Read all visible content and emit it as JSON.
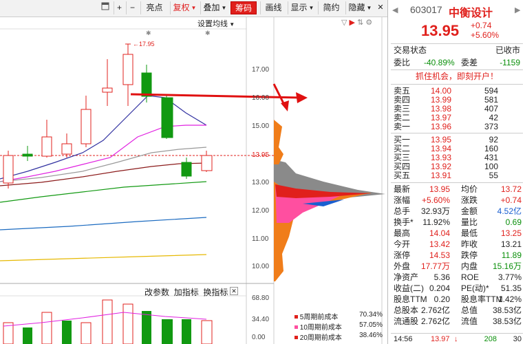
{
  "toolbar": {
    "buttons": [
      {
        "label": "亮点",
        "dropdown": false
      },
      {
        "label": "复权",
        "dropdown": true
      },
      {
        "label": "叠加",
        "dropdown": true
      },
      {
        "label": "筹码",
        "dropdown": false
      },
      {
        "label": "画线",
        "dropdown": false
      },
      {
        "label": "显示",
        "dropdown": true
      },
      {
        "label": "简约",
        "dropdown": false
      },
      {
        "label": "隐藏",
        "dropdown": true
      }
    ]
  },
  "chart": {
    "ma_settings": "设置均线",
    "high_marker": "17.95",
    "price_axis": [
      "17.00",
      "16.00",
      "15.00",
      "13.95",
      "13.00",
      "12.00",
      "11.00",
      "10.00"
    ],
    "current_price_tag": "13.95",
    "indicator_links": [
      "改参数",
      "加指标",
      "换指标"
    ],
    "volume_axis": [
      "68.80",
      "34.40",
      "0.00"
    ],
    "legend": [
      {
        "name": "5周期前成本",
        "pct": "70.34%",
        "color": "#e0201c"
      },
      {
        "name": "10周期前成本",
        "pct": "57.05%",
        "color": "#ff4fa0"
      },
      {
        "name": "20周期前成本",
        "pct": "38.46%",
        "color": "#e0201c"
      }
    ]
  },
  "side": {
    "code": "603017",
    "name": "中衡设计",
    "price": "13.95",
    "change": "+0.74",
    "change_pct": "+5.60%",
    "trade_status_label": "交易状态",
    "trade_status": "已收市",
    "weibi_label": "委比",
    "weibi": "-40.89%",
    "weicha_label": "委差",
    "weicha": "-1159",
    "promo": "抓住机会，即刻开户！",
    "asks": [
      {
        "label": "卖五",
        "price": "14.00",
        "vol": "594"
      },
      {
        "label": "卖四",
        "price": "13.99",
        "vol": "581"
      },
      {
        "label": "卖三",
        "price": "13.98",
        "vol": "407"
      },
      {
        "label": "卖二",
        "price": "13.97",
        "vol": "42"
      },
      {
        "label": "卖一",
        "price": "13.96",
        "vol": "373"
      }
    ],
    "bids": [
      {
        "label": "买一",
        "price": "13.95",
        "vol": "92"
      },
      {
        "label": "买二",
        "price": "13.94",
        "vol": "160"
      },
      {
        "label": "买三",
        "price": "13.93",
        "vol": "431"
      },
      {
        "label": "买四",
        "price": "13.92",
        "vol": "100"
      },
      {
        "label": "买五",
        "price": "13.91",
        "vol": "55"
      }
    ],
    "stats": [
      {
        "l1": "最新",
        "v1": "13.95",
        "c1": "red",
        "l2": "均价",
        "v2": "13.72",
        "c2": "red"
      },
      {
        "l1": "涨幅",
        "v1": "+5.60%",
        "c1": "red",
        "l2": "涨跌",
        "v2": "+0.74",
        "c2": "red"
      },
      {
        "l1": "总手",
        "v1": "32.93万",
        "c1": "",
        "l2": "金额",
        "v2": "4.52亿",
        "c2": "blue"
      },
      {
        "l1": "换手*",
        "v1": "11.92%",
        "c1": "",
        "l2": "量比",
        "v2": "0.69",
        "c2": "green"
      },
      {
        "l1": "最高",
        "v1": "14.04",
        "c1": "red",
        "l2": "最低",
        "v2": "13.25",
        "c2": "red"
      },
      {
        "l1": "今开",
        "v1": "13.42",
        "c1": "red",
        "l2": "昨收",
        "v2": "13.21",
        "c2": ""
      },
      {
        "l1": "涨停",
        "v1": "14.53",
        "c1": "red",
        "l2": "跌停",
        "v2": "11.89",
        "c2": "green"
      },
      {
        "l1": "外盘",
        "v1": "17.77万",
        "c1": "red",
        "l2": "内盘",
        "v2": "15.16万",
        "c2": "green"
      },
      {
        "l1": "净资产",
        "v1": "5.36",
        "c1": "",
        "l2": "ROE",
        "v2": "3.77%",
        "c2": ""
      },
      {
        "l1": "收益(二)",
        "v1": "0.204",
        "c1": "",
        "l2": "PE(动)*",
        "v2": "51.35",
        "c2": ""
      },
      {
        "l1": "股息TTM",
        "v1": "0.20",
        "c1": "",
        "l2": "股息率TTM",
        "v2": "1.42%",
        "c2": ""
      },
      {
        "l1": "总股本",
        "v1": "2.762亿",
        "c1": "",
        "l2": "总值",
        "v2": "38.53亿",
        "c2": ""
      },
      {
        "l1": "流通股",
        "v1": "2.762亿",
        "c1": "",
        "l2": "流值",
        "v2": "38.53亿",
        "c2": ""
      }
    ],
    "tick": {
      "time": "14:56",
      "price": "13.97",
      "vol": "208",
      "num": "30"
    }
  }
}
